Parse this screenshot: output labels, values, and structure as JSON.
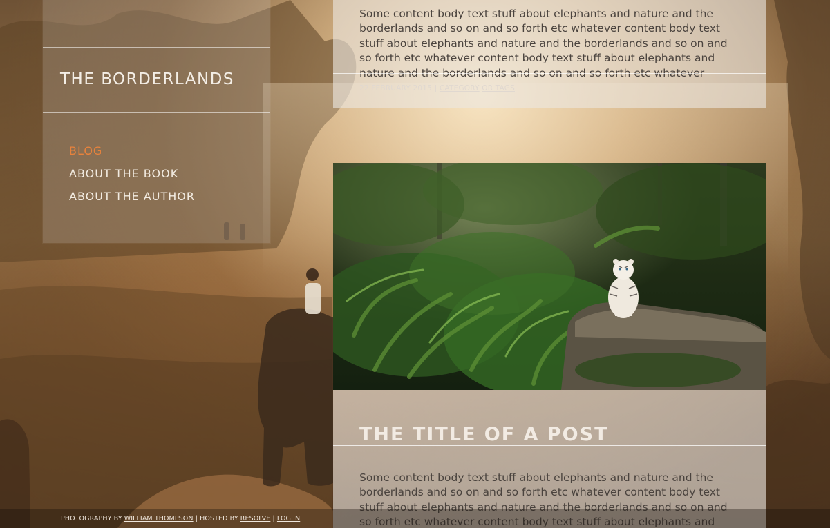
{
  "site": {
    "title": "THE BORDERLANDS"
  },
  "nav": {
    "items": [
      {
        "label": "BLOG",
        "active": true
      },
      {
        "label": "ABOUT THE BOOK",
        "active": false
      },
      {
        "label": "ABOUT THE AUTHOR",
        "active": false
      }
    ]
  },
  "posts": [
    {
      "body": "Some content body text stuff about elephants and nature and the borderlands and so on and so forth etc whatever content body text stuff about elephants and nature and the borderlands and so on and so forth etc whatever content body text stuff about elephants and nature and the borderlands and so on and so forth etc whatever",
      "date": "22 FEBRUARY 2015",
      "separator": "|",
      "category_label": "CATEGORY",
      "tags_label": "OR TAGS"
    },
    {
      "image_subject": "white tiger on rock in jungle",
      "title": "THE TITLE OF A POST",
      "body": "Some content body text stuff about elephants and nature and the borderlands and so on and so forth etc whatever content body text stuff about elephants and nature and the borderlands and so on and so forth etc whatever content body text stuff about elephants and nature and the"
    }
  ],
  "footer": {
    "photo_prefix": "PHOTOGRAPHY BY",
    "photographer": "WILLIAM THOMPSON",
    "sep1": "|",
    "hosted_prefix": "HOSTED BY",
    "host": "RESOLVE",
    "sep2": "|",
    "login": "LOG IN"
  },
  "colors": {
    "accent": "#e8823c",
    "nav_text": "#f3ece2",
    "body_text": "#4a433e"
  }
}
